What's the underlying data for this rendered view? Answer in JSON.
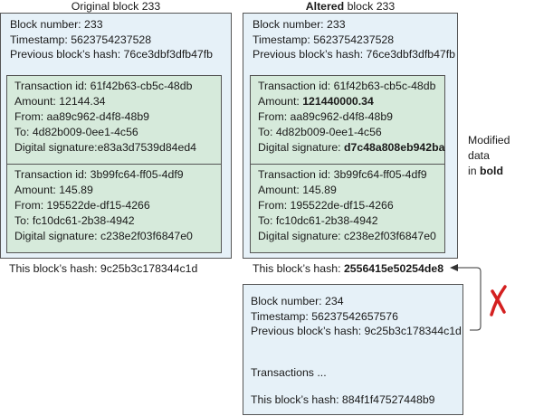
{
  "original": {
    "title": "Original block 233",
    "block_number": "Block number: 233",
    "timestamp": "Timestamp: 5623754237528",
    "prev_hash": "Previous block’s hash: 76ce3dbf3dfb47fb",
    "tx1": {
      "id": "Transaction id: 61f42b63-cb5c-48db",
      "amount": "Amount: 12144.34",
      "from": "From: aa89c962-d4f8-48b9",
      "to": "To: 4d82b009-0ee1-4c56",
      "sig": "Digital signature:e83a3d7539d84ed4"
    },
    "tx2": {
      "id": "Transaction id: 3b99fc64-ff05-4df9",
      "amount": "Amount: 145.89",
      "from": "From: 195522de-df15-4266",
      "to": "To: fc10dc61-2b38-4942",
      "sig": "Digital signature: c238e2f03f6847e0"
    },
    "hash": "This block’s hash: 9c25b3c178344c1d"
  },
  "altered": {
    "title_bold": "Altered",
    "title_rest": " block 233",
    "block_number": "Block number: 233",
    "timestamp": "Timestamp: 5623754237528",
    "prev_hash": "Previous block’s hash: 76ce3dbf3dfb47fb",
    "tx1": {
      "id": "Transaction id: 61f42b63-cb5c-48db",
      "amount_label": "Amount: ",
      "amount_value": "121440000.34",
      "from": "From: aa89c962-d4f8-48b9",
      "to": "To: 4d82b009-0ee1-4c56",
      "sig_label": "Digital signature: ",
      "sig_value": "d7c48a808eb942ba"
    },
    "tx2": {
      "id": "Transaction id: 3b99fc64-ff05-4df9",
      "amount": "Amount: 145.89",
      "from": "From: 195522de-df15-4266",
      "to": "To: fc10dc61-2b38-4942",
      "sig": "Digital signature: c238e2f03f6847e0"
    },
    "hash_label": "This block’s hash: ",
    "hash_value": "2556415e50254de8"
  },
  "next_block": {
    "block_number": "Block number: 234",
    "timestamp": "Timestamp: 56237542657576",
    "prev_hash": "Previous block’s hash: 9c25b3c178344c1d",
    "transactions": "Transactions ...",
    "hash": "This block’s hash: 884f1f47527448b9"
  },
  "note": {
    "line1": "Modified data",
    "line2_prefix": "in ",
    "line2_bold": "bold"
  },
  "colors": {
    "block_fill": "#e6f1f8",
    "transaction_fill": "#d6eadb",
    "cross": "#d42020",
    "border": "#555555"
  },
  "icons": [
    "cross-mark-icon",
    "arrow-icon"
  ]
}
